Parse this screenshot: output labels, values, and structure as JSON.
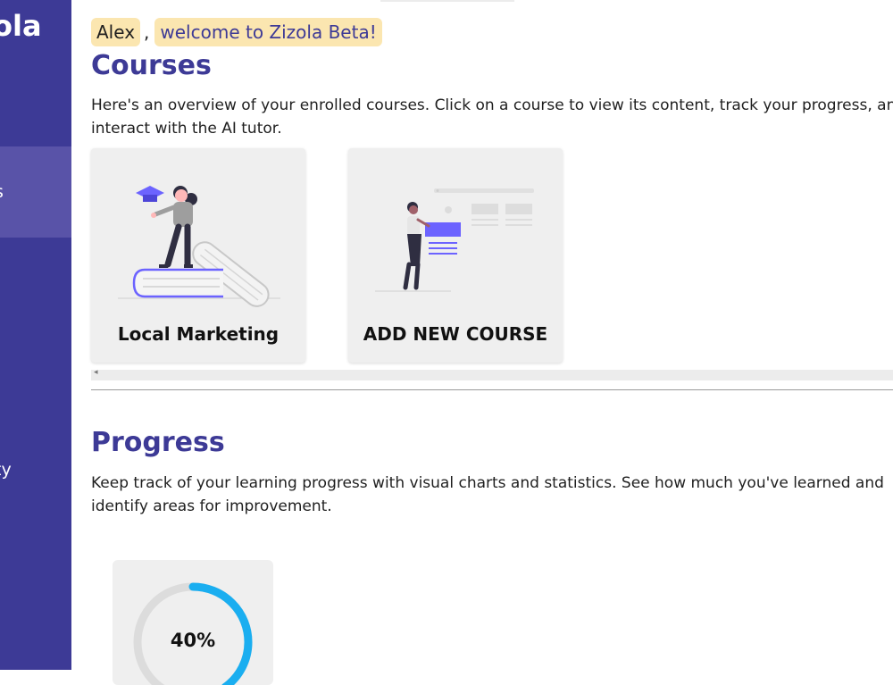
{
  "brand": {
    "name": "ola"
  },
  "sidebar": {
    "items": [
      {
        "label": "s",
        "active": true
      },
      {
        "label": "ty",
        "active": false
      }
    ]
  },
  "greeting": {
    "name": "Alex",
    "separator": ",",
    "message": "welcome to Zizola Beta!"
  },
  "courses": {
    "title": "Courses",
    "description": "Here's an overview of your enrolled courses. Click on a course to view its content, track your progress, and interact with the AI tutor.",
    "cards": [
      {
        "label": "Local Marketing"
      },
      {
        "label": "ADD NEW COURSE"
      }
    ]
  },
  "progress": {
    "title": "Progress",
    "description": "Keep track of your learning progress with visual charts and statistics. See how much you've learned and identify areas for improvement.",
    "stats": [
      {
        "value_text": "40%",
        "percent": 40
      }
    ]
  },
  "colors": {
    "sidebar": "#3d3a96",
    "accent": "#3d3a96",
    "highlight": "#fbe6b0",
    "ring": "#1aaef0",
    "illustration": "#6c63ff"
  }
}
